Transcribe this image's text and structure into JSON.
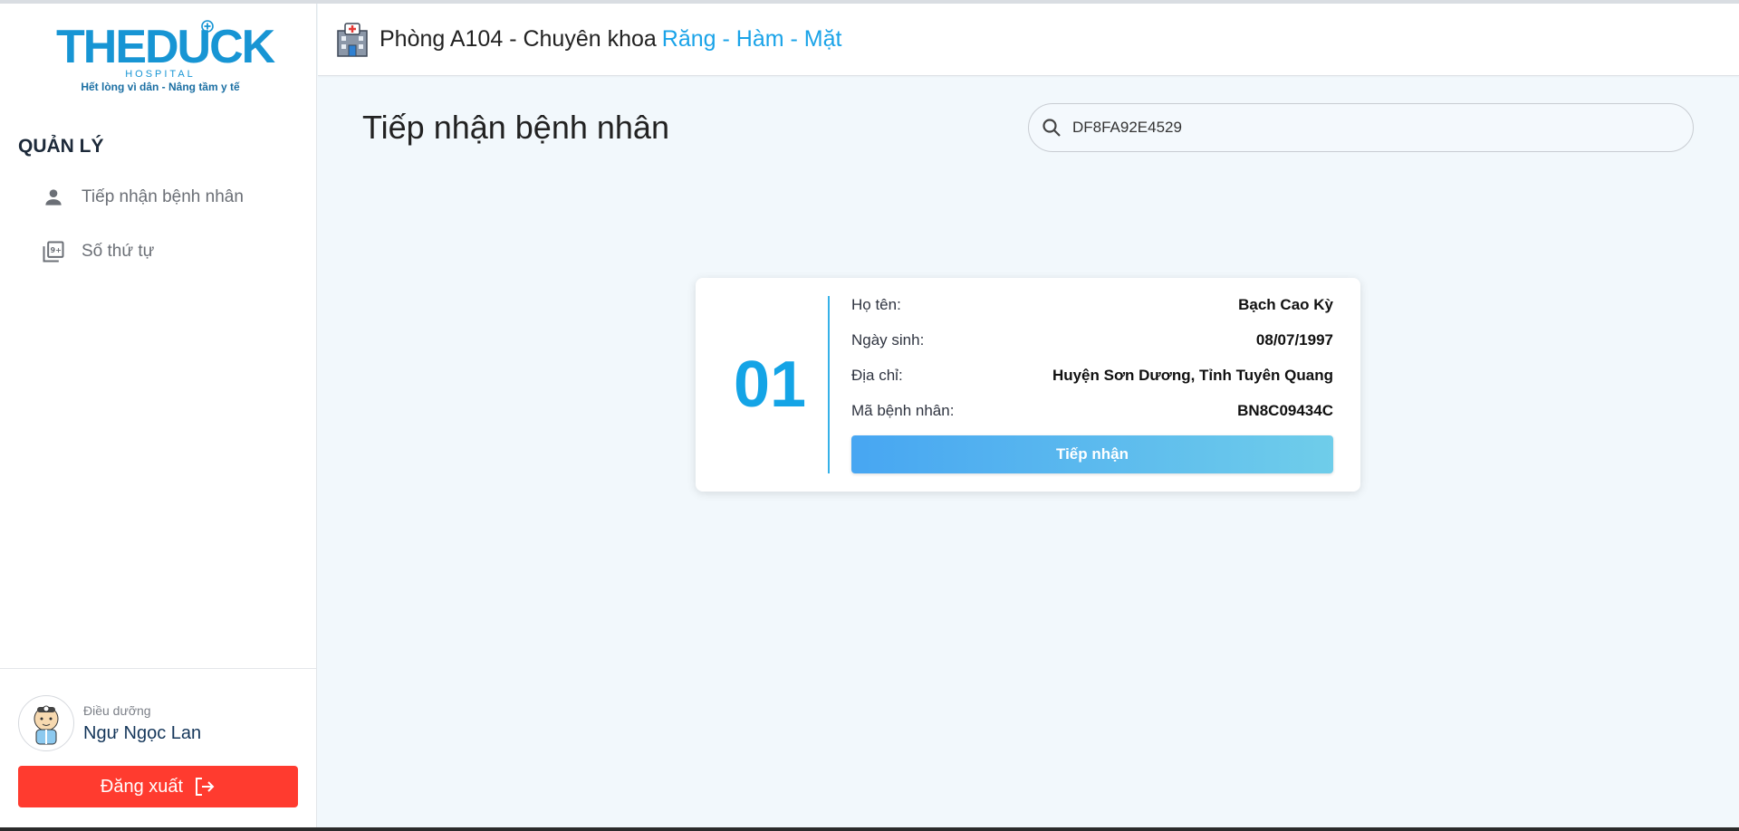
{
  "sidebar": {
    "logo": {
      "title": "THEDUCK",
      "sub1": "HOSPITAL",
      "sub2": "Hết lòng vì dân - Nâng tầm y tế"
    },
    "section_title": "QUẢN LÝ",
    "items": [
      {
        "label": "Tiếp nhận bệnh nhân",
        "icon": "person-icon"
      },
      {
        "label": "Số thứ tự",
        "icon": "queue-number-icon"
      }
    ],
    "user": {
      "role": "Điều dưỡng",
      "name": "Ngư Ngọc Lan"
    },
    "logout_label": "Đăng xuất"
  },
  "header": {
    "room": "Phòng A104 - Chuyên khoa",
    "specialty": "Răng - Hàm - Mặt"
  },
  "main": {
    "title": "Tiếp nhận bệnh nhân",
    "search": {
      "value": "DF8FA92E4529"
    },
    "patient_card": {
      "number": "01",
      "fields": [
        {
          "label": "Họ tên:",
          "value": "Bạch Cao Kỳ"
        },
        {
          "label": "Ngày sinh:",
          "value": "08/07/1997"
        },
        {
          "label": "Địa chỉ:",
          "value": "Huyện Sơn Dương, Tỉnh Tuyên Quang"
        },
        {
          "label": "Mã bệnh nhân:",
          "value": "BN8C09434C"
        }
      ],
      "accept_label": "Tiếp nhận"
    }
  },
  "colors": {
    "brand": "#1795d4",
    "accent": "#1aa3e8",
    "logout": "#ff3b2f"
  }
}
